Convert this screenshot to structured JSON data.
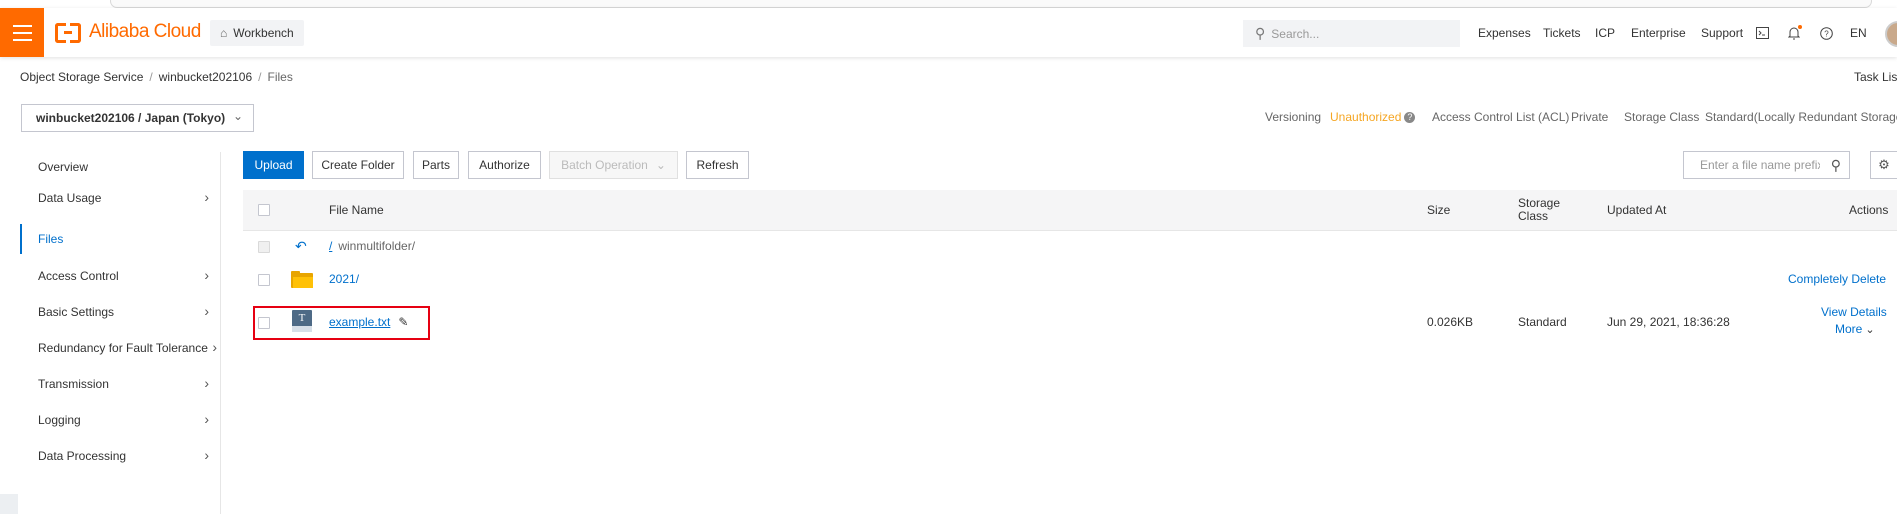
{
  "header": {
    "brand": "Alibaba Cloud",
    "workbench": "Workbench",
    "search_placeholder": "Search...",
    "links": [
      "Expenses",
      "Tickets",
      "ICP",
      "Enterprise",
      "Support"
    ],
    "lang": "EN",
    "icons": [
      "terminal-icon",
      "bell-icon",
      "help-icon"
    ]
  },
  "breadcrumb": {
    "items": [
      "Object Storage Service",
      "winbucket202106",
      "Files"
    ],
    "separator": "/"
  },
  "task_list": "Task List",
  "bucket_selector": "winbucket202106 / Japan (Tokyo)",
  "bucket_info": {
    "versioning_label": "Versioning",
    "versioning_value": "Unauthorized",
    "acl_label": "Access Control List (ACL)",
    "acl_value": "Private",
    "storage_label": "Storage Class",
    "storage_value": "Standard(Locally Redundant Storage)"
  },
  "sidebar": {
    "items": [
      {
        "label": "Overview",
        "has_arrow": false
      },
      {
        "label": "Data Usage",
        "has_arrow": true
      },
      {
        "label": "Files",
        "has_arrow": false,
        "active": true
      },
      {
        "label": "Access Control",
        "has_arrow": true
      },
      {
        "label": "Basic Settings",
        "has_arrow": true
      },
      {
        "label": "Redundancy for Fault Tolerance",
        "has_arrow": true
      },
      {
        "label": "Transmission",
        "has_arrow": true
      },
      {
        "label": "Logging",
        "has_arrow": true
      },
      {
        "label": "Data Processing",
        "has_arrow": true
      }
    ]
  },
  "toolbar": {
    "upload": "Upload",
    "create_folder": "Create Folder",
    "parts": "Parts",
    "authorize": "Authorize",
    "batch_operation": "Batch Operation",
    "refresh": "Refresh",
    "prefix_placeholder": "Enter a file name prefix"
  },
  "table": {
    "columns": {
      "name": "File Name",
      "size": "Size",
      "storage_class_line1": "Storage",
      "storage_class_line2": "Class",
      "updated": "Updated At",
      "actions": "Actions"
    },
    "parent_row": {
      "slash": "/",
      "path": "winmultifolder/"
    },
    "folder_row": {
      "name": "2021/",
      "action": "Completely Delete"
    },
    "file_row": {
      "name": "example.txt",
      "size": "0.026KB",
      "storage_class": "Standard",
      "updated": "Jun 29, 2021, 18:36:28",
      "action_view": "View Details",
      "action_more": "More"
    }
  },
  "colors": {
    "brand_orange": "#ff6a00",
    "primary_blue": "#0070cc",
    "warning": "#f5a623",
    "highlight_red": "#e60012"
  }
}
